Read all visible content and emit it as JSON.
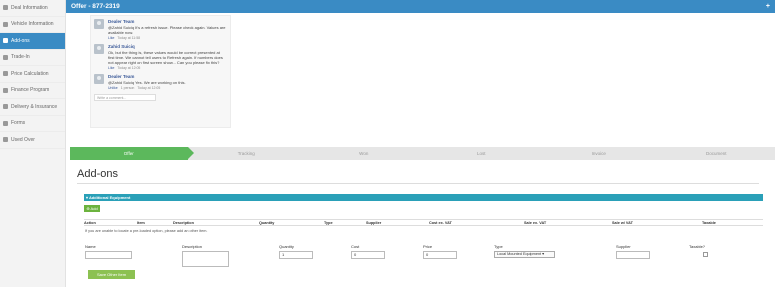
{
  "sidebar": {
    "items": [
      {
        "label": "Deal Information",
        "active": false
      },
      {
        "label": "Vehicle Information",
        "active": false
      },
      {
        "label": "Add-ons",
        "active": true
      },
      {
        "label": "Trade-In",
        "active": false
      },
      {
        "label": "Price Calculation",
        "active": false
      },
      {
        "label": "Finance Program",
        "active": false
      },
      {
        "label": "Delivery & Insurance",
        "active": false
      },
      {
        "label": "Forms",
        "active": false
      },
      {
        "label": "Used Over",
        "active": false
      }
    ]
  },
  "header": {
    "title": "Offer - 877-2319",
    "plus_label": "+"
  },
  "comments": {
    "items": [
      {
        "author": "Dealer Team",
        "text": "@Zahid Suiciq It's a refresh issue. Please check again. Values are available now.",
        "like": "Like",
        "time": "Today at 11:58"
      },
      {
        "author": "Zahid Suiciq",
        "text": "Ok, but the thing is, these values would be correct presented at first time. We cannot tell users to Refresh again. If numbers does not appear right on first screen show... Can you please fix this?",
        "like": "Like",
        "time": "Today at 12:05"
      },
      {
        "author": "Dealer Team",
        "text": "@Zahid Suiciq Yes. We are working on this.",
        "like": "Unlike",
        "likes": "1 person",
        "time": "Today at 12:05"
      }
    ],
    "write_placeholder": "Write a comment..."
  },
  "steps": [
    "Offer",
    "Tracking",
    "Won",
    "Lost",
    "Invoice",
    "Document"
  ],
  "main": {
    "title": "Add-ons",
    "equipment_bar": "▾ Additional Equipment",
    "add_button": "⊕ Add",
    "columns": [
      "Action",
      "Item",
      "Description",
      "Quantity",
      "Type",
      "Supplier",
      "Cost ex. VAT",
      "Sale ex. VAT",
      "Sale w/ VAT",
      "Taxable"
    ],
    "unable_text": "If you are unable to locate a pre-loaded option, please add an other item."
  },
  "form": {
    "name_label": "Name",
    "description_label": "Description",
    "quantity_label": "Quantity",
    "quantity_value": "1",
    "cost_label": "Cost",
    "cost_value": "0",
    "price_label": "Price",
    "price_value": "0",
    "type_label": "Type",
    "type_value": "Local Mounted Equipment ▾",
    "supplier_label": "Supplier",
    "taxable_label": "Taxable?",
    "save_label": "Save Other Item"
  }
}
